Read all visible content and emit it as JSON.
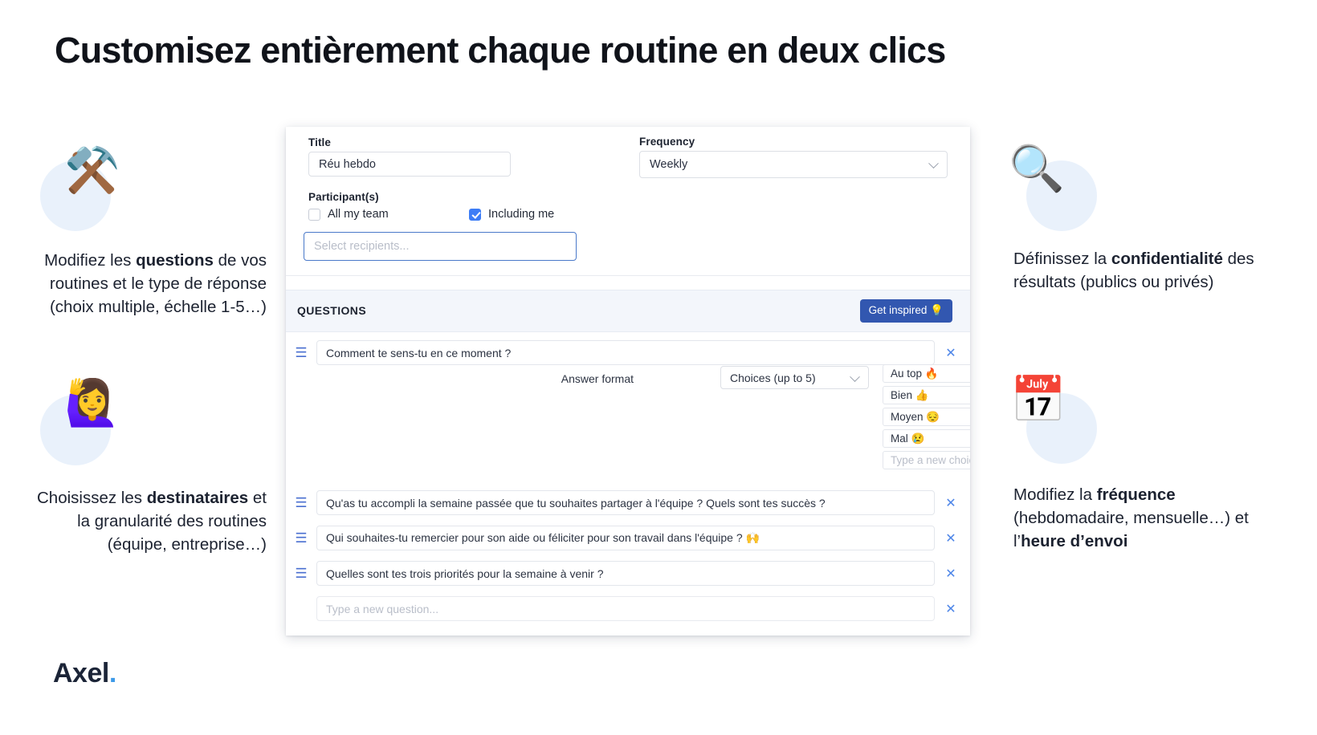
{
  "headline": "Customisez entièrement chaque routine en deux clics",
  "logo": {
    "name": "Axel",
    "dot": "."
  },
  "annotations": {
    "questions": {
      "icon": "crossed-hammers-emoji",
      "emoji": "⚒️",
      "text_html": "Modifiez les <b>questions</b> de vos routines et le type de réponse (choix multiple, échelle 1-5…)"
    },
    "recipients": {
      "icon": "person-raising-hand-emoji",
      "emoji": "🙋‍♀️",
      "text_html": "Choisissez les <b>destinataires</b> et la granularité des routines (équipe, entreprise…)"
    },
    "privacy": {
      "icon": "magnifying-glass-emoji",
      "emoji": "🔍",
      "text_html": "Définissez la <b>confidentialité</b> des résultats (publics ou privés)"
    },
    "frequency": {
      "icon": "calendar-emoji",
      "emoji": "📅",
      "text_html": "Modifiez la <b>fréquence</b> (hebdomadaire, mensuelle…) et l’<b>heure d’envoi</b>"
    }
  },
  "panel": {
    "form": {
      "title_label": "Title",
      "title_value": "Réu hebdo",
      "frequency_label": "Frequency",
      "frequency_value": "Weekly",
      "frequency_options": [
        "Weekly"
      ],
      "participants_label": "Participant(s)",
      "checkbox_all_team": {
        "label": "All my team",
        "checked": false
      },
      "checkbox_including_me": {
        "label": "Including me",
        "checked": true
      },
      "recipients_placeholder": "Select recipients..."
    },
    "questions_section": {
      "header": "QUESTIONS",
      "inspire_button": "Get inspired 💡",
      "items": [
        {
          "text": "Comment te sens-tu en ce moment ?",
          "answer_format_label": "Answer format",
          "answer_format_value": "Choices (up to 5)",
          "choices": [
            "Au top 🔥",
            "Bien 👍",
            "Moyen 😔",
            "Mal 😢"
          ],
          "new_choice_placeholder": "Type a new choice..."
        },
        {
          "text": "Qu'as tu accompli la semaine passée que tu souhaites partager à l'équipe ? Quels sont tes succès ?"
        },
        {
          "text": "Qui souhaites-tu remercier pour son aide ou féliciter pour son travail dans l'équipe ? 🙌"
        },
        {
          "text": "Quelles sont tes trois priorités pour la semaine à venir ?"
        }
      ],
      "new_question_placeholder": "Type a new question...",
      "delete_icon": "✕",
      "drag_icon": "☰"
    }
  },
  "colors": {
    "accent_blue": "#3d7df6",
    "button_blue": "#3257b0",
    "blob_blue": "#e9f1fb",
    "logo_navy": "#1b2437",
    "logo_dot_blue": "#3d9ae8"
  }
}
